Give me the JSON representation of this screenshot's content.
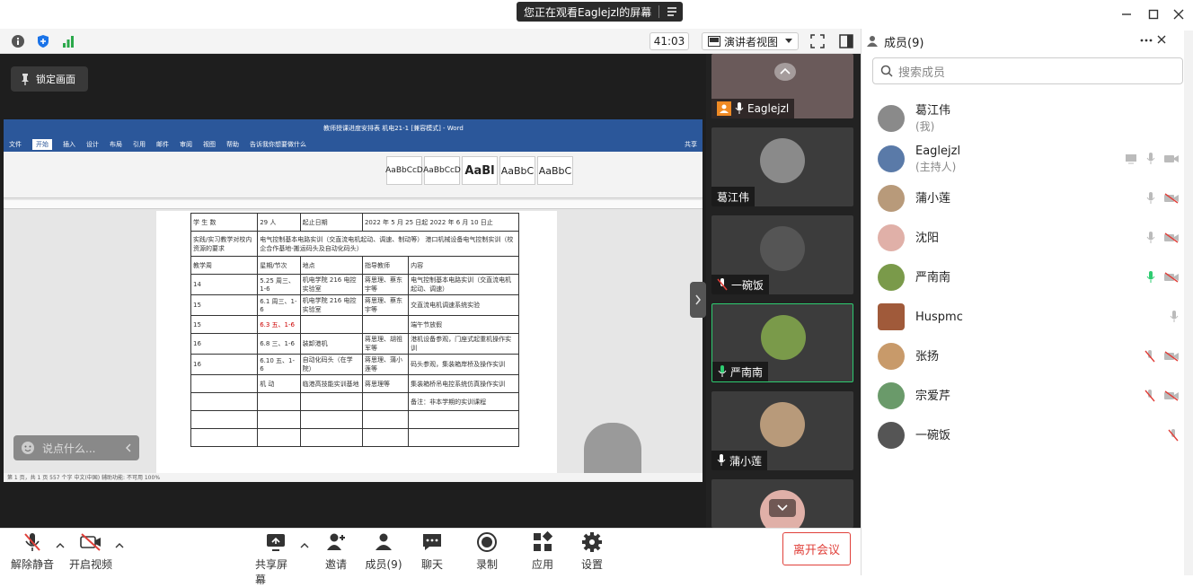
{
  "banner": {
    "text": "您正在观看Eaglejzl的屏幕"
  },
  "toolbar": {
    "timer": "41:03",
    "view_label": "演讲者视图"
  },
  "share": {
    "lock_label": "锁定画面",
    "chat_placeholder": "说点什么...",
    "word_title": "教师授课进度安排表 机电21-1  [兼容模式] - Word",
    "word_tabs": [
      "文件",
      "开始",
      "插入",
      "设计",
      "布局",
      "引用",
      "邮件",
      "审阅",
      "视图",
      "帮助",
      "告诉我你想要做什么",
      "共享"
    ],
    "styles": [
      "AaBbCcD",
      "AaBbCcD",
      "AaBl",
      "AaBbC",
      "AaBbC"
    ],
    "table_rows": [
      [
        "学 生 数",
        "29 人",
        "起止日期",
        "2022 年 5 月 25 日起 2022 年 6 月 10 日止"
      ],
      [
        "实践/实习教学对校内资源的要求",
        "电气控制基本电路实训（交直流电机起动、调速、制动等）\n港口机械设备电气控制实训（校企合作基地-搬运码头及自动化码头）",
        "",
        ""
      ],
      [
        "教学周",
        "星期/节次",
        "地点",
        "指导教师",
        "内容"
      ],
      [
        "14",
        "5.25 周三、1-6",
        "机电学院 216 电控实验室",
        "蒋思理、蔡东宇等",
        "电气控制基本电路实训（交直流电机起动、调速）"
      ],
      [
        "15",
        "6.1 周三、1-6",
        "机电学院 216 电控实验室",
        "蒋思理、蔡东宇等",
        "交直流电机调速系统实验"
      ],
      [
        "15",
        "6.3 五、1-6",
        "",
        "",
        "端午节放假"
      ],
      [
        "16",
        "6.8 三、1-6",
        "装卸港机",
        "蒋思理、胡祖军等",
        "港机设备参观，门座式起重机操作实训"
      ],
      [
        "16",
        "6.10 五、1-6",
        "自动化码头（在学院）",
        "蒋思理、蒲小莲等",
        "码头参观，集装箱岸桥及操作实训"
      ],
      [
        "",
        "机 动",
        "临港高技能实训基地",
        "蒋思理等",
        "集装箱桥吊电控系统仿真操作实训"
      ],
      [
        "",
        "",
        "",
        "",
        "备注：非本学期的实训课程"
      ]
    ],
    "status_text": "第 1 页，共 1 页   557 个字   中文(中国)   辅助功能: 不可用   100%"
  },
  "videos": [
    {
      "name": "Eaglejzl",
      "mic": "on",
      "host": true
    },
    {
      "name": "葛江伟",
      "mic": "none"
    },
    {
      "name": "一碗饭",
      "mic": "muted"
    },
    {
      "name": "严南南",
      "mic": "active"
    },
    {
      "name": "蒲小莲",
      "mic": "on"
    },
    {
      "name": "",
      "mic": "none"
    }
  ],
  "bottom": {
    "mute": "解除静音",
    "video": "开启视频",
    "share": "共享屏幕",
    "invite": "邀请",
    "members": "成员(9)",
    "chat": "聊天",
    "record": "录制",
    "apps": "应用",
    "settings": "设置",
    "leave": "离开会议"
  },
  "members_panel": {
    "title": "成员(9)",
    "search_placeholder": "搜索成员",
    "members": [
      {
        "name": "葛江伟",
        "sub": "(我)",
        "color": "#8a8a8a"
      },
      {
        "name": "Eaglejzl",
        "sub": "(主持人)",
        "color": "#5a7aa8"
      },
      {
        "name": "蒲小莲",
        "sub": "",
        "color": "#b89a7a"
      },
      {
        "name": "沈阳",
        "sub": "",
        "color": "#e0b0a8"
      },
      {
        "name": "严南南",
        "sub": "",
        "color": "#7a9a4a"
      },
      {
        "name": "Huspmc",
        "sub": "",
        "color": "#a05a3a"
      },
      {
        "name": "张扬",
        "sub": "",
        "color": "#c89a6a"
      },
      {
        "name": "宗爱芹",
        "sub": "",
        "color": "#6a9a6a"
      },
      {
        "name": "一碗饭",
        "sub": "",
        "color": "#555555"
      }
    ]
  }
}
